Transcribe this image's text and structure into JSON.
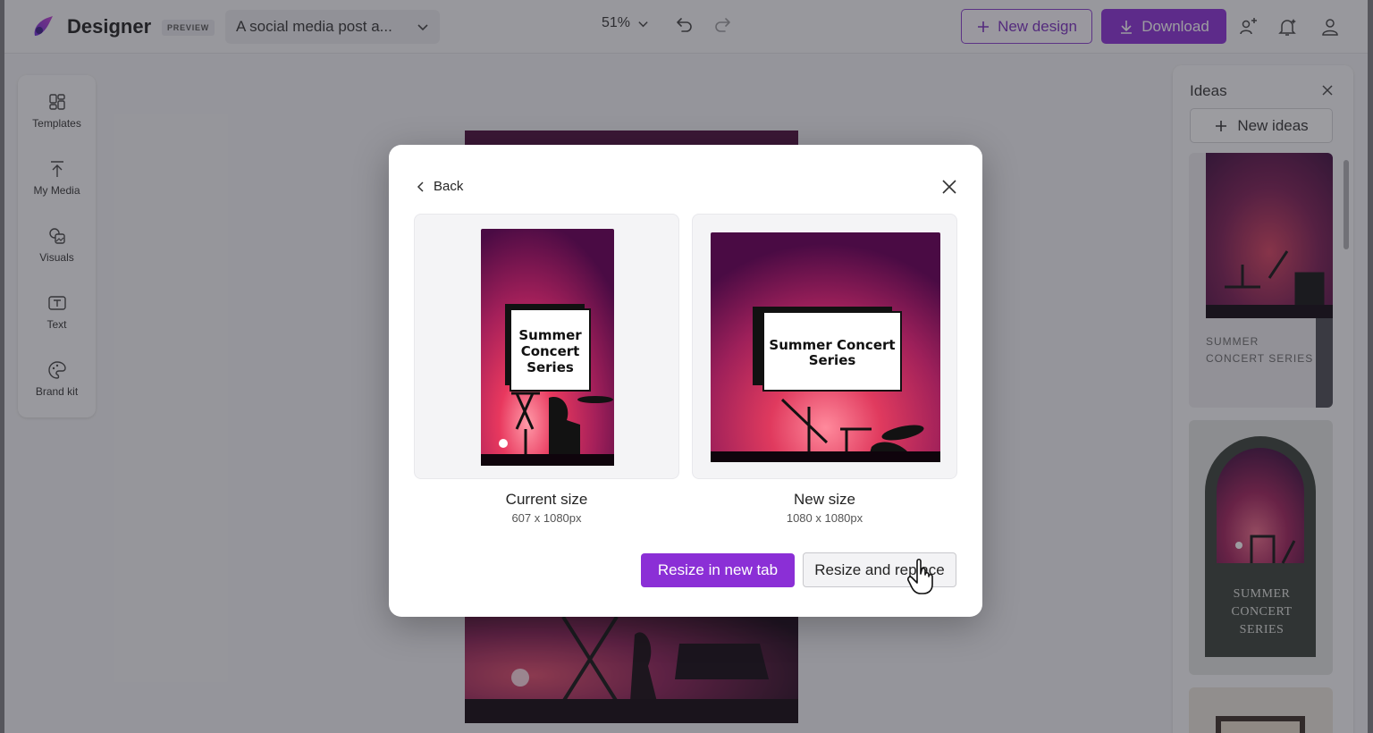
{
  "topbar": {
    "brand": "Designer",
    "preview_badge": "PREVIEW",
    "design_title": "A social media post a...",
    "zoom": "51%",
    "new_design_label": "New design",
    "download_label": "Download"
  },
  "sidebar": {
    "items": [
      {
        "label": "Templates",
        "icon": "templates-icon"
      },
      {
        "label": "My Media",
        "icon": "upload-icon"
      },
      {
        "label": "Visuals",
        "icon": "visuals-icon"
      },
      {
        "label": "Text",
        "icon": "text-icon"
      },
      {
        "label": "Brand kit",
        "icon": "palette-icon"
      }
    ]
  },
  "ideas": {
    "title": "Ideas",
    "new_ideas_label": "New ideas",
    "cards": [
      {
        "text_line1": "SUMMER",
        "text_line2": "CONCERT SERIES"
      },
      {
        "text_line1": "SUMMER",
        "text_line2": "CONCERT",
        "text_line3": "SERIES"
      }
    ]
  },
  "modal": {
    "back_label": "Back",
    "current": {
      "label": "Current size",
      "dims": "607 x 1080px",
      "poster_line1": "Summer",
      "poster_line2": "Concert",
      "poster_line3": "Series"
    },
    "new": {
      "label": "New size",
      "dims": "1080 x 1080px",
      "poster_line1": "Summer Concert",
      "poster_line2": "Series"
    },
    "resize_new_tab_label": "Resize in new tab",
    "resize_replace_label": "Resize and replace"
  },
  "colors": {
    "accent": "#8b2fd6",
    "poster_dark": "#3c0a3e",
    "poster_glow": "#e8385e"
  }
}
